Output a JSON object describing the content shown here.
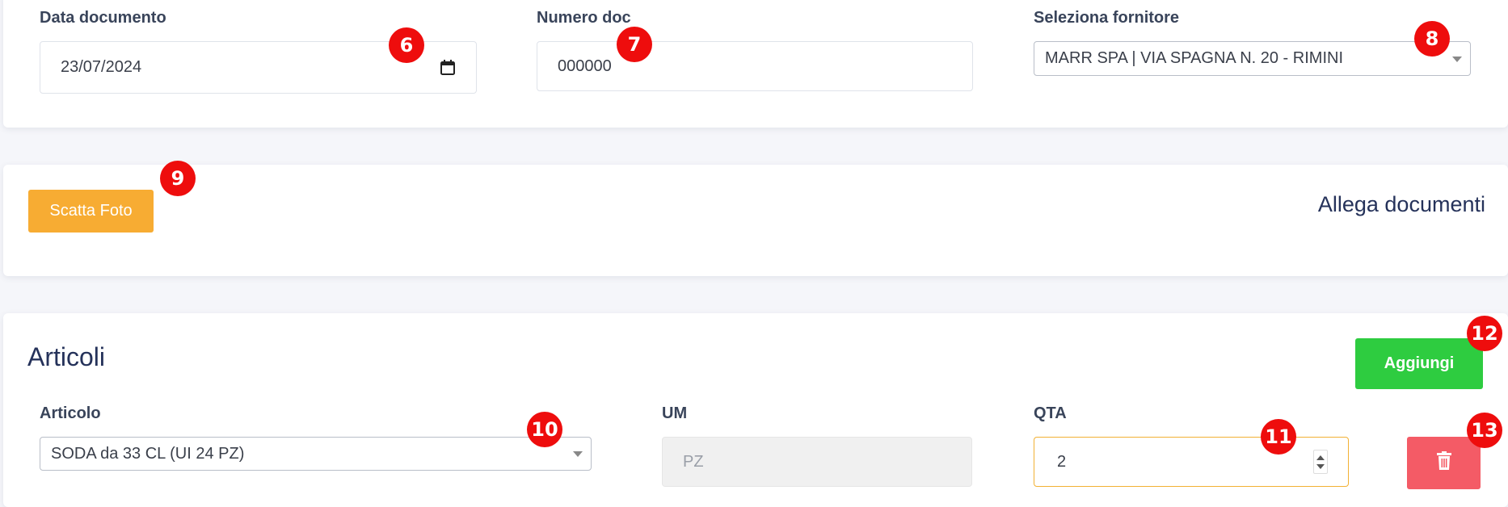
{
  "documento": {
    "data_label": "Data documento",
    "data_value": "23/07/2024",
    "numero_label": "Numero doc",
    "numero_value": "000000",
    "fornitore_label": "Seleziona fornitore",
    "fornitore_value": "MARR SPA | VIA SPAGNA N. 20 - RIMINI"
  },
  "allegati": {
    "scatta_foto_label": "Scatta Foto",
    "title": "Allega documenti"
  },
  "articoli": {
    "title": "Articoli",
    "aggiungi_label": "Aggiungi",
    "articolo_label": "Articolo",
    "articolo_value": "SODA da 33 CL (UI 24 PZ)",
    "um_label": "UM",
    "um_value": "PZ",
    "qta_label": "QTA",
    "qta_value": "2"
  },
  "markers": [
    "6",
    "7",
    "8",
    "9",
    "10",
    "11",
    "12",
    "13"
  ],
  "icons": {
    "calendar": "calendar-icon",
    "trash": "trash-icon",
    "dropdown": "chevron-down-icon",
    "spinner": "spinner-arrows-icon"
  },
  "colors": {
    "accent_orange": "#f39c12",
    "scatta_foto_bg": "#f7ac33",
    "aggiungi_bg": "#2ecc40",
    "delete_bg": "#f45b66",
    "marker_red": "#ee0d0d",
    "qta_focus_border": "#f2b134"
  }
}
